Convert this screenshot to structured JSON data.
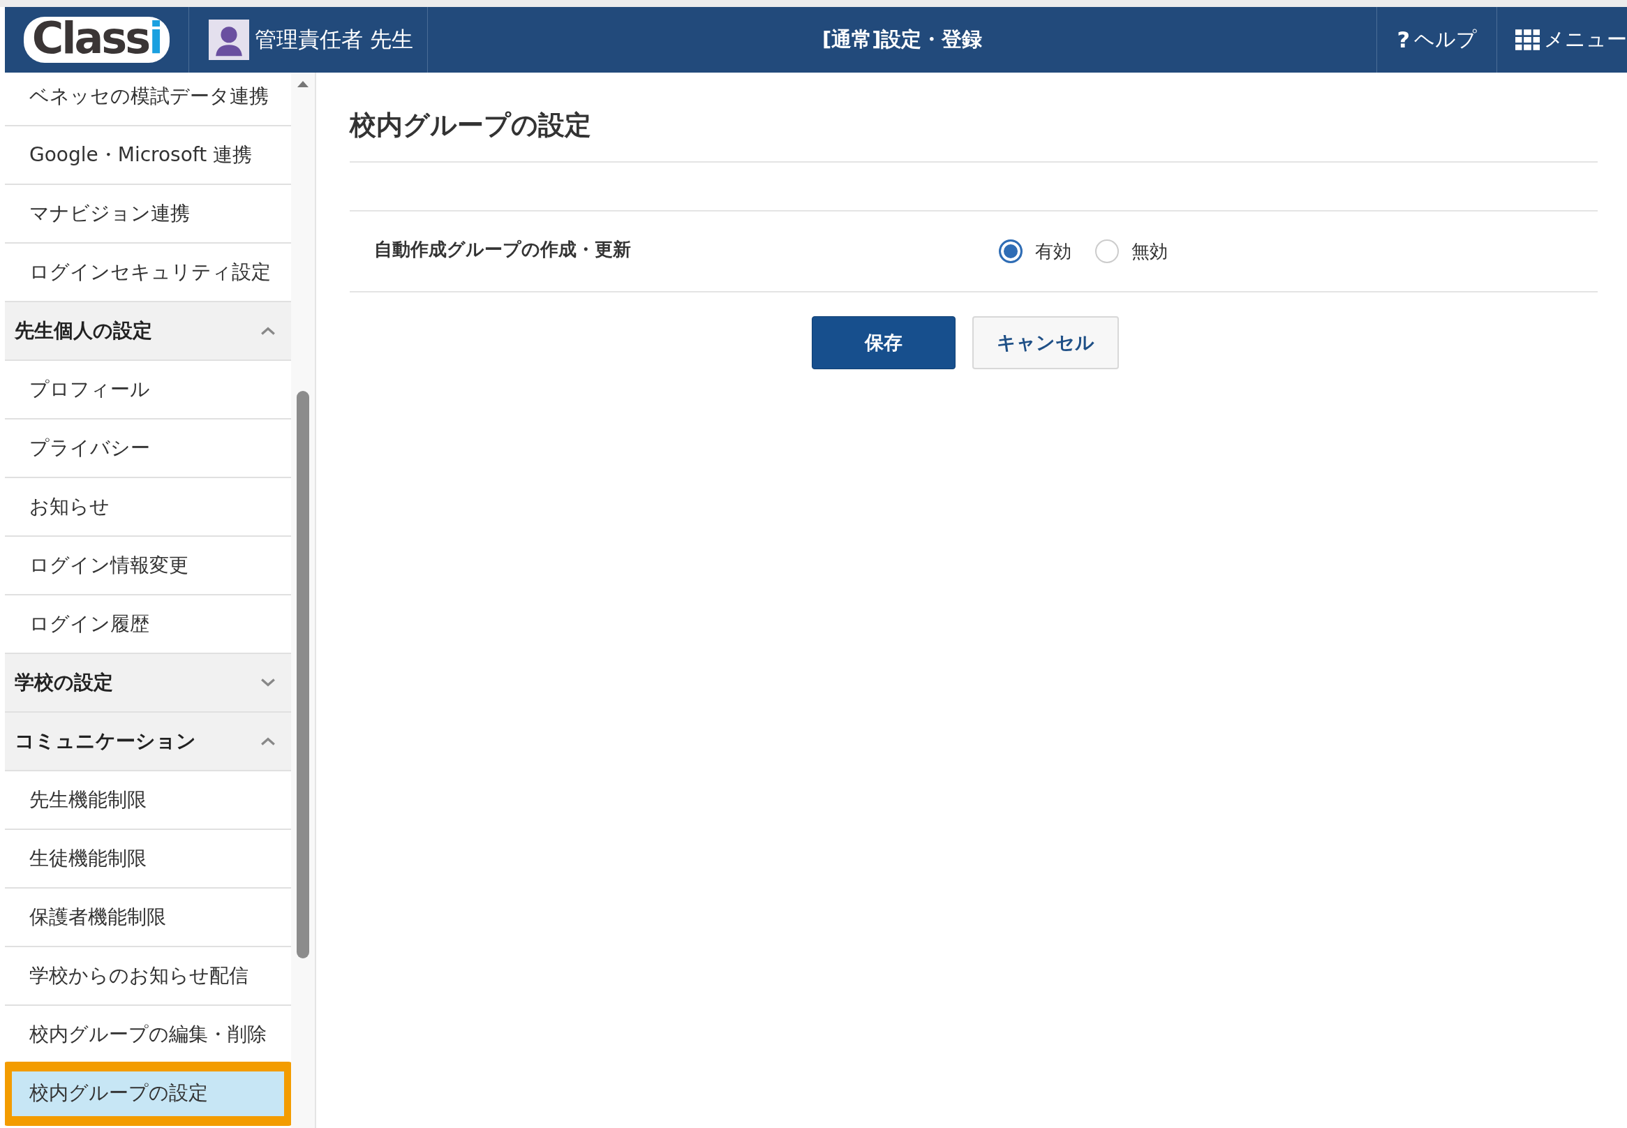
{
  "header": {
    "logo": {
      "text": "Class",
      "accent": "i"
    },
    "user": "管理責任者 先生",
    "title": "[通常]設定・登録",
    "help": {
      "icon": "?",
      "label": "ヘルプ"
    },
    "menu": "メニュー"
  },
  "sidebar": {
    "items": [
      {
        "kind": "link",
        "label": "ベネッセの模試データ連携",
        "selected": false
      },
      {
        "kind": "link",
        "label": "Google・Microsoft 連携",
        "selected": false
      },
      {
        "kind": "link",
        "label": "マナビジョン連携",
        "selected": false
      },
      {
        "kind": "link",
        "label": "ログインセキュリティ設定",
        "selected": false
      },
      {
        "kind": "section",
        "label": "先生個人の設定",
        "expanded": true,
        "children": [
          {
            "kind": "link",
            "label": "プロフィール",
            "selected": false
          },
          {
            "kind": "link",
            "label": "プライバシー",
            "selected": false
          },
          {
            "kind": "link",
            "label": "お知らせ",
            "selected": false
          },
          {
            "kind": "link",
            "label": "ログイン情報変更",
            "selected": false
          },
          {
            "kind": "link",
            "label": "ログイン履歴",
            "selected": false
          }
        ]
      },
      {
        "kind": "section",
        "label": "学校の設定",
        "expanded": false
      },
      {
        "kind": "section",
        "label": "コミュニケーション",
        "expanded": true,
        "children": [
          {
            "kind": "link",
            "label": "先生機能制限",
            "selected": false
          },
          {
            "kind": "link",
            "label": "生徒機能制限",
            "selected": false
          },
          {
            "kind": "link",
            "label": "保護者機能制限",
            "selected": false
          },
          {
            "kind": "link",
            "label": "学校からのお知らせ配信",
            "selected": false
          },
          {
            "kind": "link",
            "label": "校内グループの編集・削除",
            "selected": false
          },
          {
            "kind": "link",
            "label": "校内グループの設定",
            "selected": true
          }
        ]
      }
    ]
  },
  "main": {
    "title": "校内グループの設定",
    "setting": {
      "label": "自動作成グループの作成・更新",
      "options": [
        {
          "label": "有効",
          "selected": true
        },
        {
          "label": "無効",
          "selected": false
        }
      ]
    },
    "buttons": [
      {
        "kind": "primary",
        "label": "保存"
      },
      {
        "kind": "secondary",
        "label": "キャンセル"
      }
    ]
  }
}
